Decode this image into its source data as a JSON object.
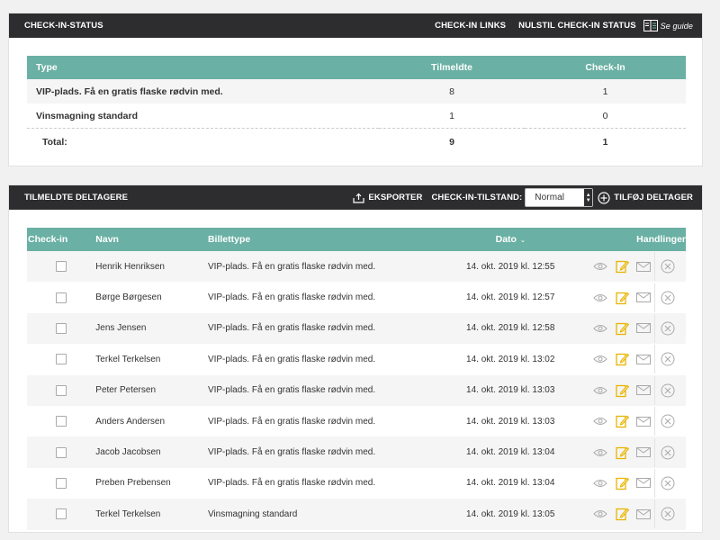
{
  "status_panel": {
    "title": "CHECK-IN-STATUS",
    "links": [
      "CHECK-IN LINKS",
      "NULSTIL CHECK-IN STATUS"
    ],
    "guide_label": "Se guide",
    "columns": [
      "Type",
      "Tilmeldte",
      "Check-In"
    ],
    "rows": [
      {
        "type": "VIP-plads. Få en gratis flaske rødvin med.",
        "tilmeldte": "8",
        "checkin": "1"
      },
      {
        "type": "Vinsmagning standard",
        "tilmeldte": "1",
        "checkin": "0"
      }
    ],
    "total": {
      "label": "Total:",
      "tilmeldte": "9",
      "checkin": "1"
    }
  },
  "participants_panel": {
    "title": "TILMELDTE DELTAGERE",
    "export_label": "EKSPORTER",
    "state_label": "CHECK-IN-TILSTAND:",
    "state_value": "Normal",
    "add_label": "TILFØJ DELTAGER",
    "columns": {
      "checkin": "Check-in",
      "name": "Navn",
      "ticket": "Billettype",
      "date": "Dato",
      "actions": "Handlinger"
    },
    "rows": [
      {
        "name": "Henrik Henriksen",
        "ticket": "VIP-plads. Få en gratis flaske rødvin med.",
        "date": "14. okt. 2019 kl. 12:55"
      },
      {
        "name": "Børge Børgesen",
        "ticket": "VIP-plads. Få en gratis flaske rødvin med.",
        "date": "14. okt. 2019 kl. 12:57"
      },
      {
        "name": "Jens Jensen",
        "ticket": "VIP-plads. Få en gratis flaske rødvin med.",
        "date": "14. okt. 2019 kl. 12:58"
      },
      {
        "name": "Terkel Terkelsen",
        "ticket": "VIP-plads. Få en gratis flaske rødvin med.",
        "date": "14. okt. 2019 kl. 13:02"
      },
      {
        "name": "Peter Petersen",
        "ticket": "VIP-plads. Få en gratis flaske rødvin med.",
        "date": "14. okt. 2019 kl. 13:03"
      },
      {
        "name": "Anders Andersen",
        "ticket": "VIP-plads. Få en gratis flaske rødvin med.",
        "date": "14. okt. 2019 kl. 13:03"
      },
      {
        "name": "Jacob Jacobsen",
        "ticket": "VIP-plads. Få en gratis flaske rødvin med.",
        "date": "14. okt. 2019 kl. 13:04"
      },
      {
        "name": "Preben Prebensen",
        "ticket": "VIP-plads. Få en gratis flaske rødvin med.",
        "date": "14. okt. 2019 kl. 13:04"
      },
      {
        "name": "Terkel Terkelsen",
        "ticket": "Vinsmagning standard",
        "date": "14. okt. 2019 kl. 13:05"
      }
    ]
  },
  "colors": {
    "header_bg": "#2d2d2f",
    "table_header": "#6ab0a4",
    "edit_icon": "#e8b400"
  }
}
